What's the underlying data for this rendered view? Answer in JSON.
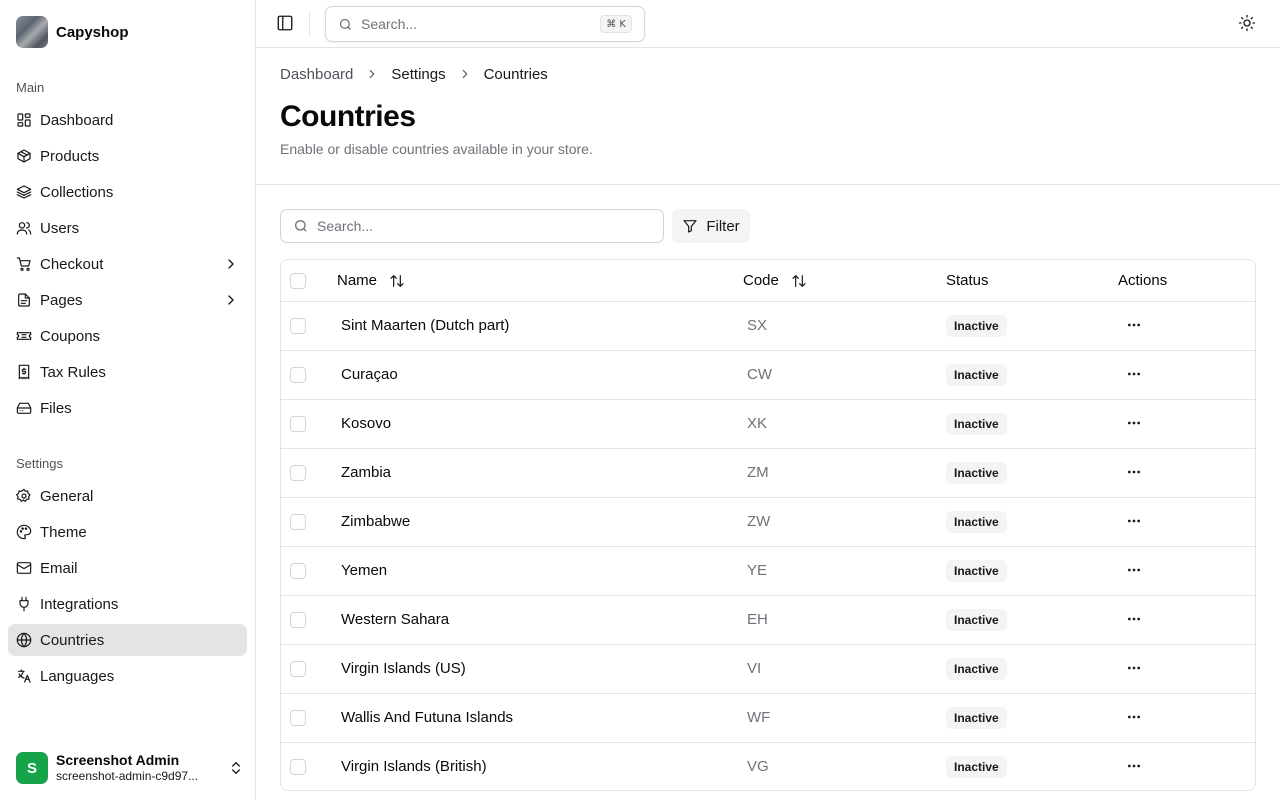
{
  "brand": {
    "name": "Capyshop",
    "logo_icon": "capybara-logo"
  },
  "sidebar": {
    "main_label": "Main",
    "main_items": [
      {
        "label": "Dashboard",
        "icon": "dashboard-icon"
      },
      {
        "label": "Products",
        "icon": "package-icon"
      },
      {
        "label": "Collections",
        "icon": "layers-icon"
      },
      {
        "label": "Users",
        "icon": "users-icon"
      },
      {
        "label": "Checkout",
        "icon": "cart-icon",
        "has_submenu": true
      },
      {
        "label": "Pages",
        "icon": "file-icon",
        "has_submenu": true
      },
      {
        "label": "Coupons",
        "icon": "ticket-icon"
      },
      {
        "label": "Tax Rules",
        "icon": "receipt-icon"
      },
      {
        "label": "Files",
        "icon": "drive-icon"
      }
    ],
    "settings_label": "Settings",
    "settings_items": [
      {
        "label": "General",
        "icon": "gear-icon"
      },
      {
        "label": "Theme",
        "icon": "palette-icon"
      },
      {
        "label": "Email",
        "icon": "mail-icon"
      },
      {
        "label": "Integrations",
        "icon": "plug-icon"
      },
      {
        "label": "Countries",
        "icon": "globe-icon",
        "active": true
      },
      {
        "label": "Languages",
        "icon": "languages-icon"
      }
    ]
  },
  "user": {
    "initial": "S",
    "name": "Screenshot Admin",
    "email": "screenshot-admin-c9d97...",
    "avatar_color": "#16a34a"
  },
  "topbar": {
    "search_placeholder": "Search...",
    "shortcut": "⌘ K"
  },
  "breadcrumb": [
    "Dashboard",
    "Settings",
    "Countries"
  ],
  "page": {
    "title": "Countries",
    "subtitle": "Enable or disable countries available in your store."
  },
  "toolbar": {
    "search_placeholder": "Search...",
    "filter_label": "Filter"
  },
  "table": {
    "columns": {
      "name": "Name",
      "code": "Code",
      "status": "Status",
      "actions": "Actions"
    },
    "rows": [
      {
        "name": "Sint Maarten (Dutch part)",
        "code": "SX",
        "status": "Inactive"
      },
      {
        "name": "Curaçao",
        "code": "CW",
        "status": "Inactive"
      },
      {
        "name": "Kosovo",
        "code": "XK",
        "status": "Inactive"
      },
      {
        "name": "Zambia",
        "code": "ZM",
        "status": "Inactive"
      },
      {
        "name": "Zimbabwe",
        "code": "ZW",
        "status": "Inactive"
      },
      {
        "name": "Yemen",
        "code": "YE",
        "status": "Inactive"
      },
      {
        "name": "Western Sahara",
        "code": "EH",
        "status": "Inactive"
      },
      {
        "name": "Virgin Islands (US)",
        "code": "VI",
        "status": "Inactive"
      },
      {
        "name": "Wallis And Futuna Islands",
        "code": "WF",
        "status": "Inactive"
      },
      {
        "name": "Virgin Islands (British)",
        "code": "VG",
        "status": "Inactive"
      }
    ]
  },
  "colors": {
    "active_nav_bg": "#e4e4e7",
    "badge_bg": "#f4f4f5",
    "border": "#e4e4e7",
    "muted_text": "#71717a"
  }
}
